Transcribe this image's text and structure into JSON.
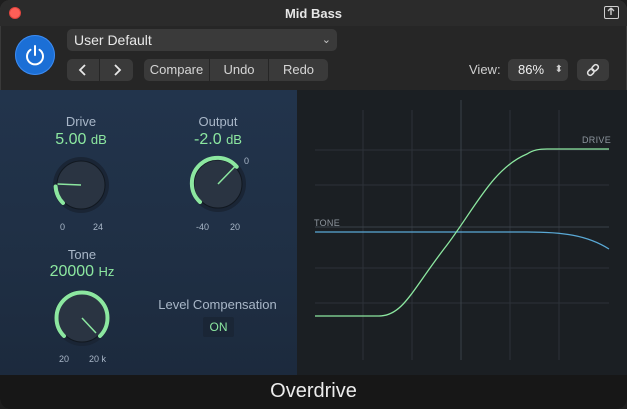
{
  "window": {
    "title": "Mid Bass"
  },
  "header": {
    "preset": "User Default",
    "compare_label": "Compare",
    "undo_label": "Undo",
    "redo_label": "Redo",
    "view_label": "View:",
    "view_zoom": "86%"
  },
  "controls": {
    "drive": {
      "label": "Drive",
      "value": "5.00",
      "unit": "dB",
      "min_label": "0",
      "max_label": "24"
    },
    "output": {
      "label": "Output",
      "value": "-2.0",
      "unit": "dB",
      "min_label": "-40",
      "mid_label": "0",
      "max_label": "20"
    },
    "tone": {
      "label": "Tone",
      "value": "20000",
      "unit": "Hz",
      "min_label": "20",
      "max_label": "20 k"
    },
    "level_compensation": {
      "label": "Level Compensation",
      "state": "ON"
    }
  },
  "graph": {
    "tone_label": "TONE",
    "drive_label": "DRIVE"
  },
  "footer": {
    "plugin_name": "Overdrive"
  },
  "colors": {
    "accent_green": "#8ce7a0",
    "tone_curve": "#5aa9d6",
    "power_blue": "#1b6fd6"
  }
}
